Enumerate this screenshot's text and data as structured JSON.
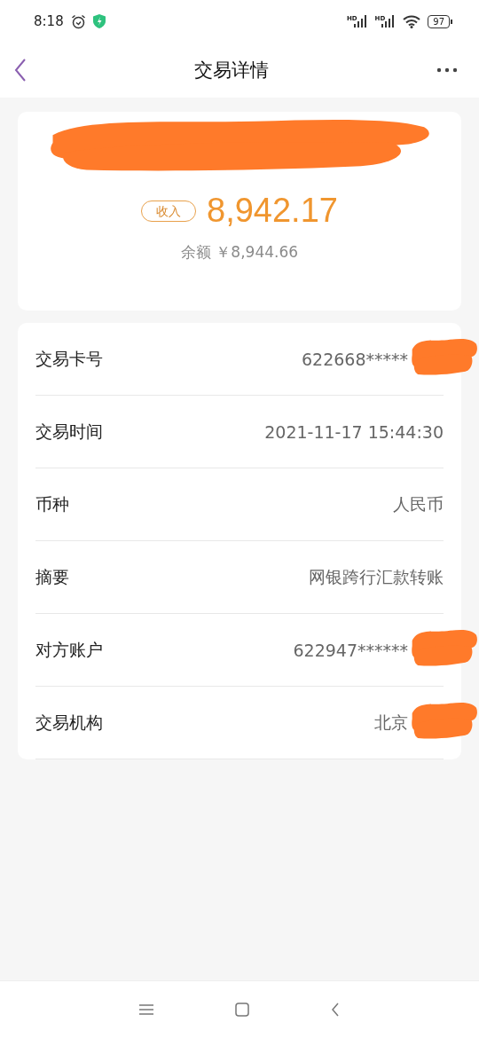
{
  "status_bar": {
    "time": "8:18",
    "signals": [
      "HD",
      "HD"
    ],
    "battery": "97"
  },
  "nav": {
    "title": "交易详情"
  },
  "summary": {
    "redacted": true,
    "tag": "收入",
    "amount": "8,942.17",
    "balance": "余额 ￥8,944.66"
  },
  "details": [
    {
      "label": "交易卡号",
      "value": "622668*****",
      "redacted": true
    },
    {
      "label": "交易时间",
      "value": "2021-11-17 15:44:30",
      "redacted": false
    },
    {
      "label": "币种",
      "value": "人民币",
      "redacted": false
    },
    {
      "label": "摘要",
      "value": "网银跨行汇款转账",
      "redacted": false
    },
    {
      "label": "对方账户",
      "value": "622947******",
      "redacted": true
    },
    {
      "label": "交易机构",
      "value": "北京",
      "redacted": true
    }
  ]
}
